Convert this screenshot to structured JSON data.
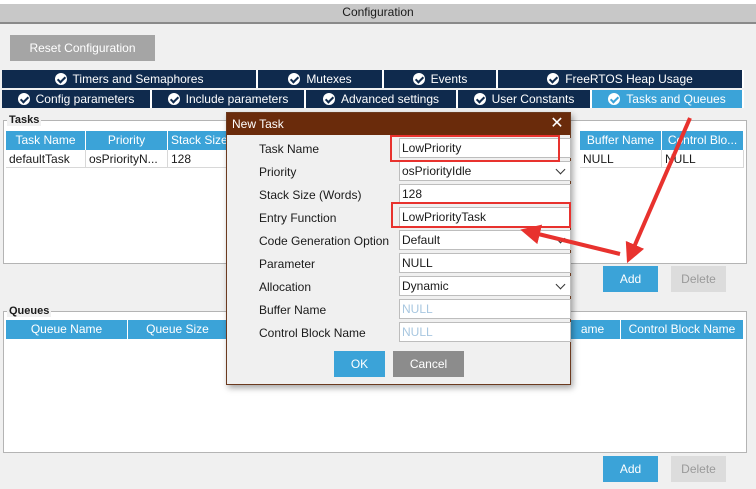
{
  "window": {
    "title": "Configuration"
  },
  "toolbar": {
    "reset_label": "Reset Configuration"
  },
  "tabs_row1": [
    {
      "label": "Timers and Semaphores"
    },
    {
      "label": "Mutexes"
    },
    {
      "label": "Events"
    },
    {
      "label": "FreeRTOS Heap Usage"
    }
  ],
  "tabs_row2": [
    {
      "label": "Config parameters"
    },
    {
      "label": "Include parameters"
    },
    {
      "label": "Advanced settings"
    },
    {
      "label": "User Constants"
    },
    {
      "label": "Tasks and Queues",
      "active": true
    }
  ],
  "tasks": {
    "group_label": "Tasks",
    "columns": [
      "Task Name",
      "Priority",
      "Stack Size",
      "Buffer Name",
      "Control Blo..."
    ],
    "rows": [
      [
        "defaultTask",
        "osPriorityN...",
        "128",
        "NULL",
        "NULL"
      ]
    ],
    "add_label": "Add",
    "delete_label": "Delete"
  },
  "queues": {
    "group_label": "Queues",
    "columns": [
      "Queue Name",
      "Queue Size",
      "ame",
      "Control Block Name"
    ],
    "add_label": "Add",
    "delete_label": "Delete"
  },
  "dialog": {
    "title": "New Task",
    "close_glyph": "✕",
    "fields": {
      "task_name": {
        "label": "Task Name",
        "value": "LowPriority"
      },
      "priority": {
        "label": "Priority",
        "value": "osPriorityIdle"
      },
      "stack_size": {
        "label": "Stack Size (Words)",
        "value": "128"
      },
      "entry_function": {
        "label": "Entry Function",
        "value": "LowPriorityTask"
      },
      "code_gen": {
        "label": "Code Generation Option",
        "value": "Default"
      },
      "parameter": {
        "label": "Parameter",
        "value": "NULL"
      },
      "allocation": {
        "label": "Allocation",
        "value": "Dynamic"
      },
      "buffer_name": {
        "label": "Buffer Name",
        "value": "NULL"
      },
      "control_block": {
        "label": "Control Block Name",
        "value": "NULL"
      }
    },
    "ok_label": "OK",
    "cancel_label": "Cancel"
  },
  "annotation": {
    "highlight_color": "#e8322e"
  }
}
